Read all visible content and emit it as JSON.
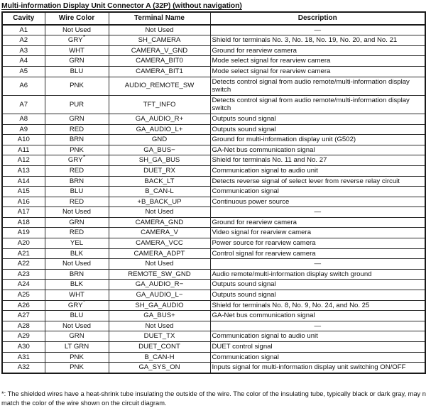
{
  "document": {
    "title": "Multi-information Display Unit Connector A (32P) (without navigation)",
    "footnote": "*: The shielded wires have a heat-shrink tube insulating the outside of the wire. The color of the insulating tube, typically black or dark gray, may not match the color of the wire shown on the circuit diagram.",
    "shield_marker": "*",
    "not_used_label": "Not Used",
    "empty_dash": "—"
  },
  "table": {
    "columns": [
      {
        "key": "cavity",
        "label": "Cavity"
      },
      {
        "key": "wire_color",
        "label": "Wire Color"
      },
      {
        "key": "terminal_name",
        "label": "Terminal Name"
      },
      {
        "key": "description",
        "label": "Description"
      }
    ],
    "rows": [
      {
        "cavity": "A1",
        "wire_color": "Not Used",
        "shielded": false,
        "terminal_name": "Not Used",
        "description": "—",
        "dash": true
      },
      {
        "cavity": "A2",
        "wire_color": "GRY",
        "shielded": true,
        "terminal_name": "SH_CAMERA",
        "description": "Shield for terminals No. 3, No. 18, No. 19, No. 20, and No. 21",
        "dash": false
      },
      {
        "cavity": "A3",
        "wire_color": "WHT",
        "shielded": false,
        "terminal_name": "CAMERA_V_GND",
        "description": "Ground for rearview camera",
        "dash": false
      },
      {
        "cavity": "A4",
        "wire_color": "GRN",
        "shielded": false,
        "terminal_name": "CAMERA_BIT0",
        "description": "Mode select signal for rearview camera",
        "dash": false
      },
      {
        "cavity": "A5",
        "wire_color": "BLU",
        "shielded": false,
        "terminal_name": "CAMERA_BIT1",
        "description": "Mode select signal for rearview camera",
        "dash": false
      },
      {
        "cavity": "A6",
        "wire_color": "PNK",
        "shielded": false,
        "terminal_name": "AUDIO_REMOTE_SW",
        "description": "Detects control signal from audio remote/multi-information display switch",
        "dash": false
      },
      {
        "cavity": "A7",
        "wire_color": "PUR",
        "shielded": false,
        "terminal_name": "TFT_INFO",
        "description": "Detects control signal from audio remote/multi-information display switch",
        "dash": false
      },
      {
        "cavity": "A8",
        "wire_color": "GRN",
        "shielded": false,
        "terminal_name": "GA_AUDIO_R+",
        "description": "Outputs sound signal",
        "dash": false
      },
      {
        "cavity": "A9",
        "wire_color": "RED",
        "shielded": false,
        "terminal_name": "GA_AUDIO_L+",
        "description": "Outputs sound signal",
        "dash": false
      },
      {
        "cavity": "A10",
        "wire_color": "BRN",
        "shielded": false,
        "terminal_name": "GND",
        "description": "Ground for multi-information display unit (G502)",
        "dash": false
      },
      {
        "cavity": "A11",
        "wire_color": "PNK",
        "shielded": false,
        "terminal_name": "GA_BUS−",
        "description": "GA-Net bus communication signal",
        "dash": false
      },
      {
        "cavity": "A12",
        "wire_color": "GRY",
        "shielded": true,
        "terminal_name": "SH_GA_BUS",
        "description": "Shield for terminals No. 11 and No. 27",
        "dash": false
      },
      {
        "cavity": "A13",
        "wire_color": "RED",
        "shielded": false,
        "terminal_name": "DUET_RX",
        "description": "Communication signal to audio unit",
        "dash": false
      },
      {
        "cavity": "A14",
        "wire_color": "BRN",
        "shielded": false,
        "terminal_name": "BACK_LT",
        "description": "Detects reverse signal of select lever from reverse relay circuit",
        "dash": false
      },
      {
        "cavity": "A15",
        "wire_color": "BLU",
        "shielded": false,
        "terminal_name": "B_CAN-L",
        "description": "Communication signal",
        "dash": false
      },
      {
        "cavity": "A16",
        "wire_color": "RED",
        "shielded": false,
        "terminal_name": "+B_BACK_UP",
        "description": "Continuous power source",
        "dash": false
      },
      {
        "cavity": "A17",
        "wire_color": "Not Used",
        "shielded": false,
        "terminal_name": "Not Used",
        "description": "—",
        "dash": true
      },
      {
        "cavity": "A18",
        "wire_color": "GRN",
        "shielded": false,
        "terminal_name": "CAMERA_GND",
        "description": "Ground for rearview camera",
        "dash": false
      },
      {
        "cavity": "A19",
        "wire_color": "RED",
        "shielded": false,
        "terminal_name": "CAMERA_V",
        "description": "Video signal for rearview camera",
        "dash": false
      },
      {
        "cavity": "A20",
        "wire_color": "YEL",
        "shielded": false,
        "terminal_name": "CAMERA_VCC",
        "description": "Power source for rearview camera",
        "dash": false
      },
      {
        "cavity": "A21",
        "wire_color": "BLK",
        "shielded": false,
        "terminal_name": "CAMERA_ADPT",
        "description": "Control signal for rearview camera",
        "dash": false
      },
      {
        "cavity": "A22",
        "wire_color": "Not Used",
        "shielded": false,
        "terminal_name": "Not Used",
        "description": "—",
        "dash": true
      },
      {
        "cavity": "A23",
        "wire_color": "BRN",
        "shielded": false,
        "terminal_name": "REMOTE_SW_GND",
        "description": "Audio remote/multi-information display switch ground",
        "dash": false
      },
      {
        "cavity": "A24",
        "wire_color": "BLK",
        "shielded": false,
        "terminal_name": "GA_AUDIO_R−",
        "description": "Outputs sound signal",
        "dash": false
      },
      {
        "cavity": "A25",
        "wire_color": "WHT",
        "shielded": false,
        "terminal_name": "GA_AUDIO_L−",
        "description": "Outputs sound signal",
        "dash": false
      },
      {
        "cavity": "A26",
        "wire_color": "GRY",
        "shielded": true,
        "terminal_name": "SH_GA_AUDIO",
        "description": "Shield for terminals No. 8, No. 9, No. 24, and No. 25",
        "dash": false
      },
      {
        "cavity": "A27",
        "wire_color": "BLU",
        "shielded": false,
        "terminal_name": "GA_BUS+",
        "description": "GA-Net bus communication signal",
        "dash": false
      },
      {
        "cavity": "A28",
        "wire_color": "Not Used",
        "shielded": false,
        "terminal_name": "Not Used",
        "description": "—",
        "dash": true
      },
      {
        "cavity": "A29",
        "wire_color": "GRN",
        "shielded": false,
        "terminal_name": "DUET_TX",
        "description": "Communication signal to audio unit",
        "dash": false
      },
      {
        "cavity": "A30",
        "wire_color": "LT GRN",
        "shielded": false,
        "terminal_name": "DUET_CONT",
        "description": "DUET control signal",
        "dash": false
      },
      {
        "cavity": "A31",
        "wire_color": "PNK",
        "shielded": false,
        "terminal_name": "B_CAN-H",
        "description": "Communication signal",
        "dash": false
      },
      {
        "cavity": "A32",
        "wire_color": "PNK",
        "shielded": false,
        "terminal_name": "GA_SYS_ON",
        "description": "Inputs signal for multi-information display unit switching ON/OFF",
        "dash": false
      }
    ]
  }
}
